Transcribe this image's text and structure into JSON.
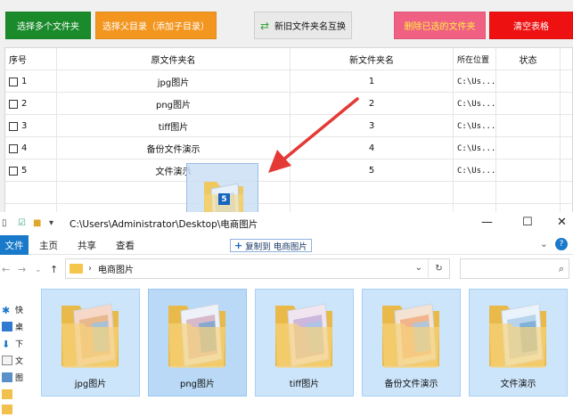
{
  "toolbar": {
    "select_multi": "选择多个文件夹",
    "select_parent": "选择父目录（添加子目录）",
    "swap": "新旧文件夹名互换",
    "delete_selected": "删除已选的文件夹",
    "clear_table": "清空表格"
  },
  "table": {
    "headers": [
      "序号",
      "原文件夹名",
      "新文件夹名",
      "所在位置",
      "状态"
    ],
    "rows": [
      {
        "index": "1",
        "original": "jpg图片",
        "new": "1",
        "location": "C:\\Us...",
        "status": ""
      },
      {
        "index": "2",
        "original": "png图片",
        "new": "2",
        "location": "C:\\Us...",
        "status": ""
      },
      {
        "index": "3",
        "original": "tiff图片",
        "new": "3",
        "location": "C:\\Us...",
        "status": ""
      },
      {
        "index": "4",
        "original": "备份文件演示",
        "new": "4",
        "location": "C:\\Us...",
        "status": ""
      },
      {
        "index": "5",
        "original": "文件演示",
        "new": "5",
        "location": "C:\\Us...",
        "status": ""
      }
    ]
  },
  "drag": {
    "count_badge": "5",
    "tooltip": "复制到 电商图片"
  },
  "explorer": {
    "title_path": "C:\\Users\\Administrator\\Desktop\\电商图片",
    "ribbon_tabs": [
      "文件",
      "主页",
      "共享",
      "查看"
    ],
    "address_folder": "电商图片",
    "sidebar_items": [
      "快",
      "桌",
      "下",
      "文",
      "图",
      "",
      ""
    ],
    "files": [
      "jpg图片",
      "png图片",
      "tiff图片",
      "备份文件演示",
      "文件演示"
    ]
  },
  "colors": {
    "green": "#1a8a2b",
    "orange": "#f3961f",
    "pink": "#f06082",
    "red": "#ee1111",
    "arrow": "#e53935",
    "accent_blue": "#1979ca"
  }
}
